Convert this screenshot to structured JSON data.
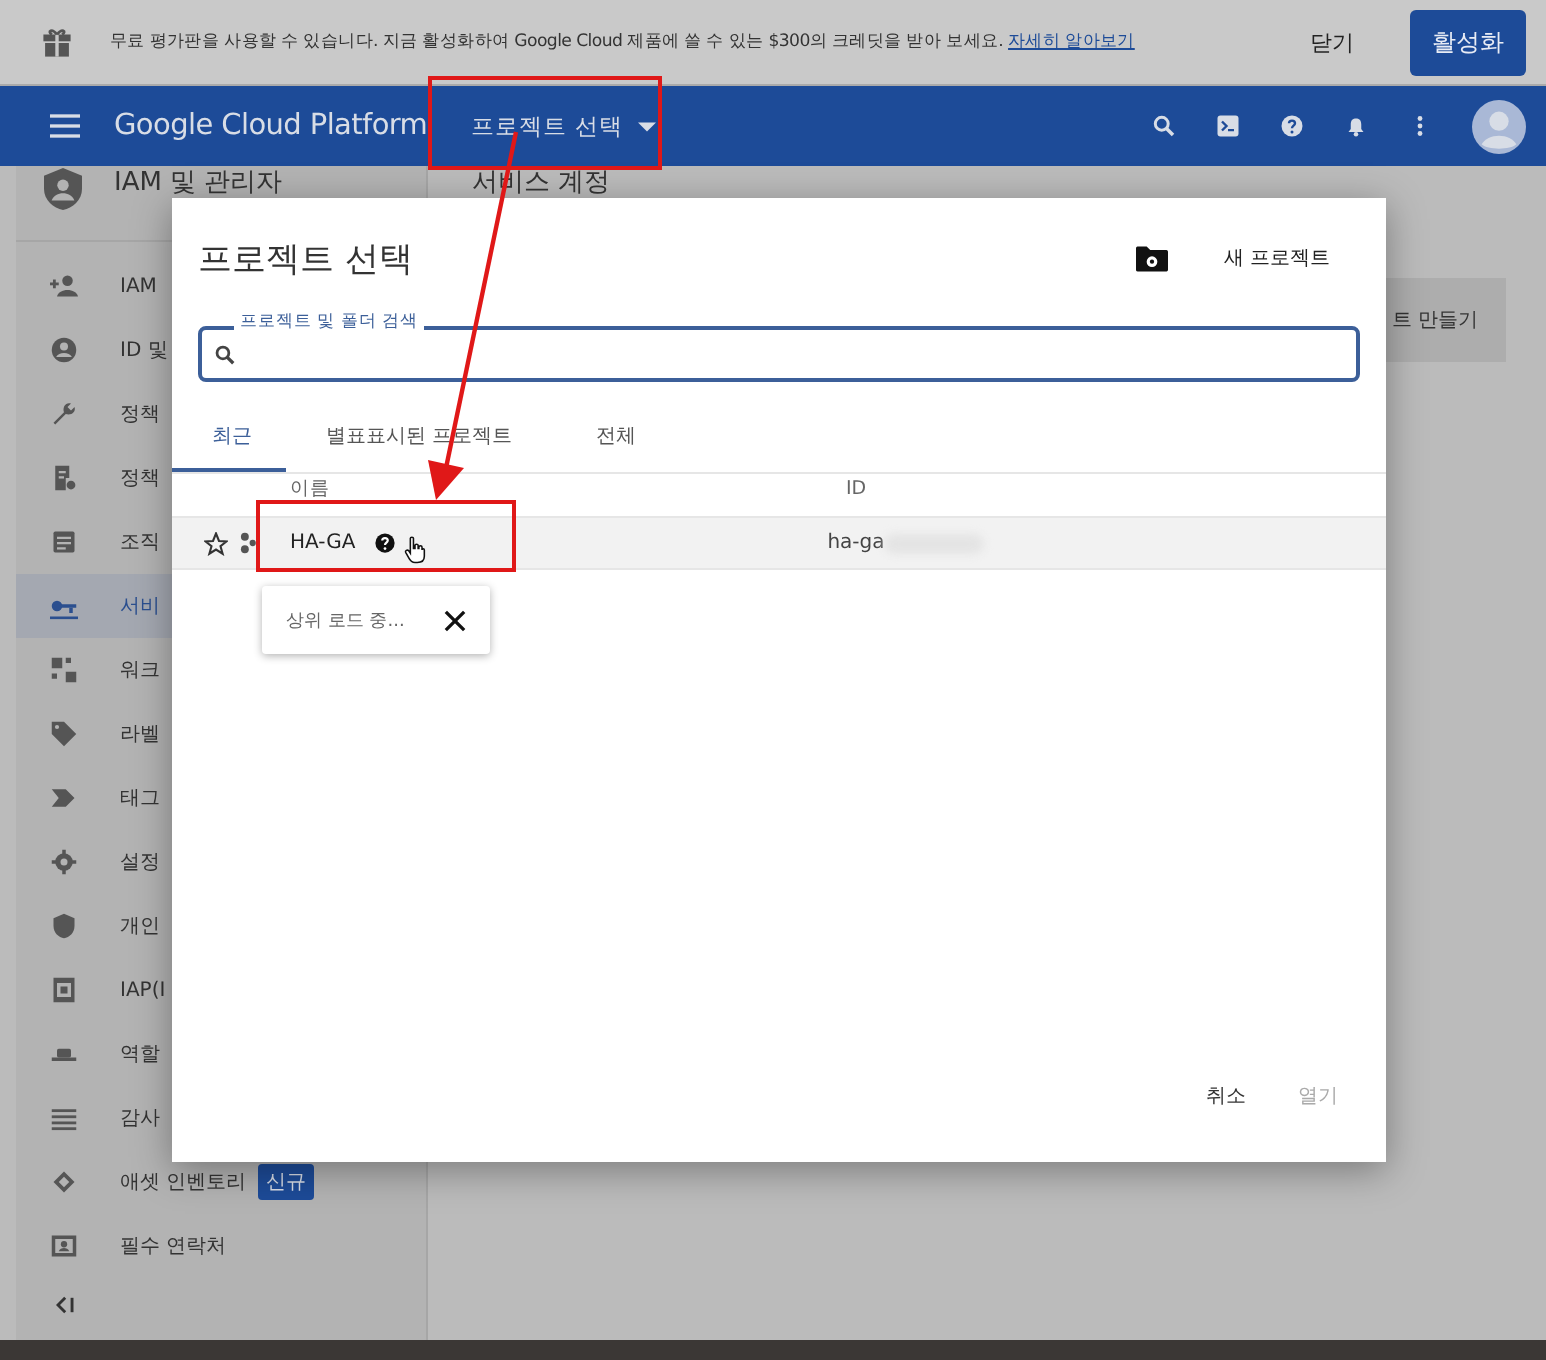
{
  "banner": {
    "text": "무료 평가판을 사용할 수 있습니다. 지금 활성화하여 Google Cloud 제품에 쓸 수 있는 $300의 크레딧을 받아 보세요.",
    "link": "자세히 알아보기",
    "dismiss": "닫기",
    "activate": "활성화"
  },
  "header": {
    "product": "Google Cloud Platform",
    "project_picker": "프로젝트 선택"
  },
  "sidebar": {
    "title": "IAM 및 관리자",
    "items": [
      {
        "label": "IAM",
        "selected": false
      },
      {
        "label": "ID 및",
        "selected": false
      },
      {
        "label": "정책",
        "selected": false
      },
      {
        "label": "정책",
        "selected": false
      },
      {
        "label": "조직",
        "selected": false
      },
      {
        "label": "서비",
        "selected": true
      },
      {
        "label": "워크",
        "selected": false
      },
      {
        "label": "라벨",
        "selected": false
      },
      {
        "label": "태그",
        "selected": false
      },
      {
        "label": "설정",
        "selected": false
      },
      {
        "label": "개인",
        "selected": false
      },
      {
        "label": "IAP(I",
        "selected": false
      },
      {
        "label": "역할",
        "selected": false
      },
      {
        "label": "감사",
        "selected": false
      },
      {
        "label": "애셋 인벤토리",
        "badge": "신규",
        "selected": false
      },
      {
        "label": "필수 연락처",
        "selected": false
      }
    ]
  },
  "page": {
    "title": "서비스 계정",
    "create_button": "트 만들기"
  },
  "dialog": {
    "title": "프로젝트 선택",
    "new_project": "새 프로젝트",
    "search": {
      "label": "프로젝트 및 폴더 검색"
    },
    "tabs": [
      {
        "label": "최근",
        "selected": true
      },
      {
        "label": "별표표시된 프로젝트",
        "selected": false
      },
      {
        "label": "전체",
        "selected": false
      }
    ],
    "columns": [
      "이름",
      "ID"
    ],
    "rows": [
      {
        "name": "HA-GA",
        "id": "ha-ga",
        "starred": false,
        "selected": true
      }
    ],
    "tooltip": {
      "text": "상위 로드 중..."
    },
    "buttons": [
      {
        "label": "취소",
        "disabled": false
      },
      {
        "label": "열기",
        "disabled": true
      }
    ]
  }
}
